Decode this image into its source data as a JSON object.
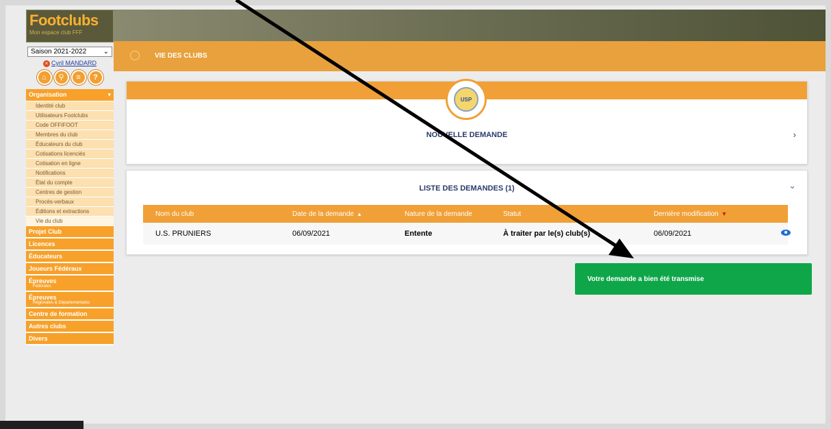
{
  "app": {
    "logo_main": "Foot",
    "logo_accent": "clubs",
    "logo_sub": "Mon espace club FFF"
  },
  "sidebar": {
    "season": "Saison 2021-2022",
    "user": "Cyril MANDARD",
    "section": "Organisation",
    "items": [
      {
        "label": "Identité club"
      },
      {
        "label": "Utilisateurs Footclubs"
      },
      {
        "label": "Code OFFIFOOT"
      },
      {
        "label": "Membres du club"
      },
      {
        "label": "Éducateurs du club"
      },
      {
        "label": "Cotisations licenciés"
      },
      {
        "label": "Cotisation en ligne"
      },
      {
        "label": "Notifications"
      },
      {
        "label": "État du compte"
      },
      {
        "label": "Centres de gestion"
      },
      {
        "label": "Procès-verbaux"
      },
      {
        "label": "Éditions et extractions"
      },
      {
        "label": "Vie du club"
      }
    ],
    "sections": [
      {
        "label": "Projet Club",
        "sub": ""
      },
      {
        "label": "Licences",
        "sub": ""
      },
      {
        "label": "Éducateurs",
        "sub": ""
      },
      {
        "label": "Joueurs Fédéraux",
        "sub": ""
      },
      {
        "label": "Épreuves",
        "sub": "Fédérales"
      },
      {
        "label": "Épreuves",
        "sub": "Régionales & Départementales"
      },
      {
        "label": "Centre de formation",
        "sub": ""
      },
      {
        "label": "Autres clubs",
        "sub": ""
      },
      {
        "label": "Divers",
        "sub": ""
      }
    ]
  },
  "header": {
    "title": "VIE DES CLUBS"
  },
  "new_request": {
    "badge": "USP",
    "title": "NOUVELLE DEMANDE"
  },
  "request_list": {
    "title": "LISTE DES DEMANDES (1)",
    "columns": [
      "Nom du club",
      "Date de la demande",
      "Nature de la demande",
      "Statut",
      "Dernière modification"
    ],
    "rows": [
      {
        "club": "U.S. PRUNIERS",
        "date": "06/09/2021",
        "nature": "Entente",
        "status": "À traiter par le(s) club(s)",
        "modified": "06/09/2021"
      }
    ]
  },
  "toast": {
    "message": "Votre demande a bien été transmise"
  },
  "colors": {
    "accent": "#f0a036",
    "success": "#0fa64a"
  }
}
